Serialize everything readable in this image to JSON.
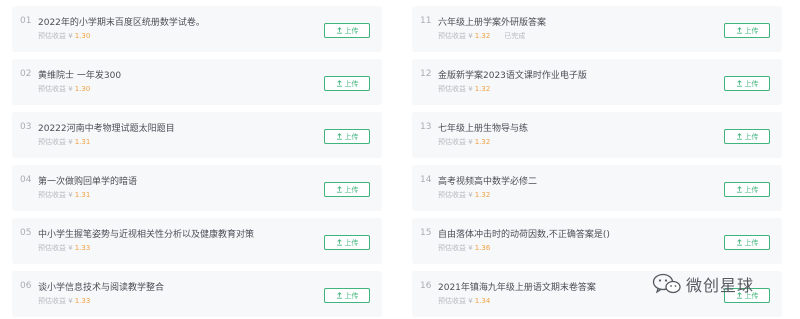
{
  "items_left": [
    {
      "index": "01",
      "title": "2022年的小学期末百度区统册数学试卷。",
      "meta_label": "预估收益 ¥",
      "price": "1.30",
      "status": "",
      "button": "上传"
    },
    {
      "index": "02",
      "title": "黄维院士 一年发300",
      "meta_label": "预估收益 ¥",
      "price": "1.30",
      "status": "",
      "button": "上传"
    },
    {
      "index": "03",
      "title": "20222河南中考物理试题太阳题目",
      "meta_label": "预估收益 ¥",
      "price": "1.31",
      "status": "",
      "button": "上传"
    },
    {
      "index": "04",
      "title": "第一次做购回单学的暗语",
      "meta_label": "预估收益 ¥",
      "price": "1.31",
      "status": "",
      "button": "上传"
    },
    {
      "index": "05",
      "title": "中小学生握笔姿势与近视相关性分析以及健康教育对策",
      "meta_label": "预估收益 ¥",
      "price": "1.33",
      "status": "",
      "button": "上传"
    },
    {
      "index": "06",
      "title": "谈小学信息技术与阅读教学整合",
      "meta_label": "预估收益 ¥",
      "price": "1.33",
      "status": "",
      "button": "上传"
    }
  ],
  "items_right": [
    {
      "index": "11",
      "title": "六年级上册学案外研版答案",
      "meta_label": "预估收益 ¥",
      "price": "1.32",
      "status": "已完成",
      "button": "上传"
    },
    {
      "index": "12",
      "title": "金版新学案2023语文课时作业电子版",
      "meta_label": "预估收益 ¥",
      "price": "1.32",
      "status": "",
      "button": "上传"
    },
    {
      "index": "13",
      "title": "七年级上册生物导与练",
      "meta_label": "预估收益 ¥",
      "price": "1.32",
      "status": "",
      "button": "上传"
    },
    {
      "index": "14",
      "title": "高考视频高中数学必修二",
      "meta_label": "预估收益 ¥",
      "price": "1.32",
      "status": "",
      "button": "上传"
    },
    {
      "index": "15",
      "title": "自由落体冲击时的动荷因数,不正确答案是()",
      "meta_label": "预估收益 ¥",
      "price": "1.36",
      "status": "",
      "button": "上传"
    },
    {
      "index": "16",
      "title": "2021年镇海九年级上册语文期末卷答案",
      "meta_label": "预估收益 ¥",
      "price": "1.34",
      "status": "",
      "button": "上传"
    }
  ],
  "watermark": {
    "text": "微创星球",
    "icon": "wechat-icon"
  },
  "colors": {
    "accent": "#3fb47c",
    "price": "#f0a246",
    "card_bg": "#f7f8f9"
  }
}
